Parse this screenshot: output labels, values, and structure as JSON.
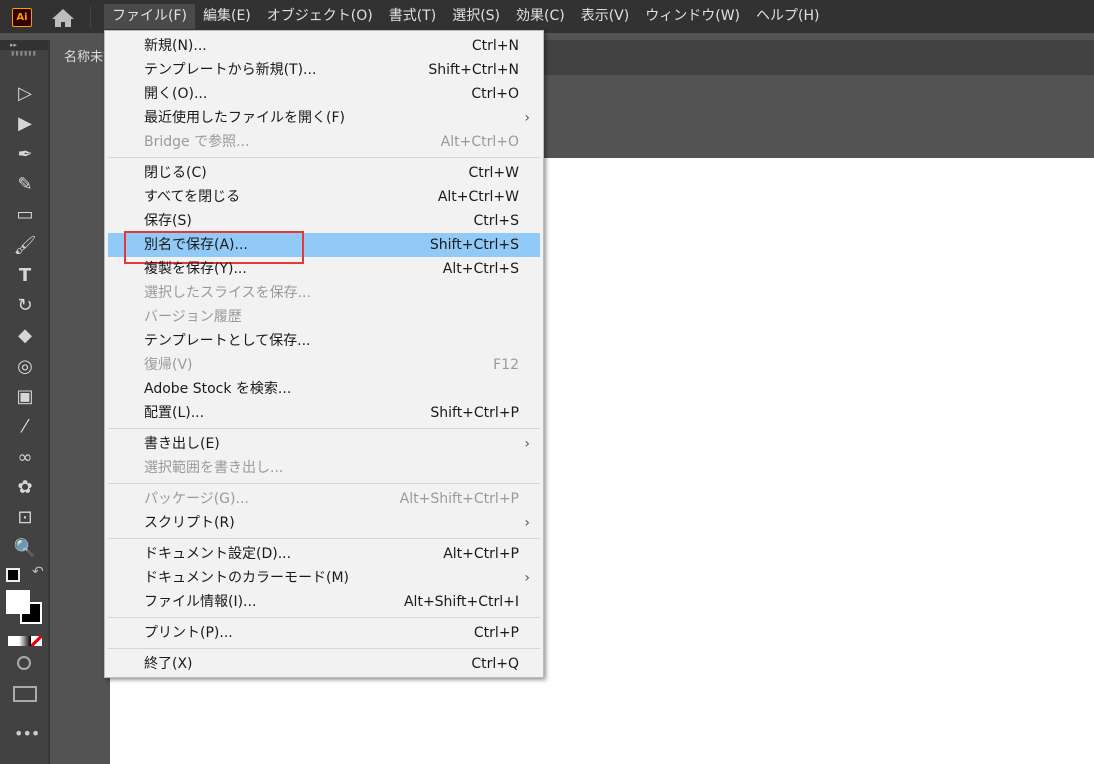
{
  "menubar": {
    "logo": "Ai",
    "items": [
      "ファイル(F)",
      "編集(E)",
      "オブジェクト(O)",
      "書式(T)",
      "選択(S)",
      "効果(C)",
      "表示(V)",
      "ウィンドウ(W)",
      "ヘルプ(H)"
    ]
  },
  "document_tab": "名称未設定",
  "file_menu": [
    {
      "label": "新規(N)...",
      "shortcut": "Ctrl+N"
    },
    {
      "label": "テンプレートから新規(T)...",
      "shortcut": "Shift+Ctrl+N"
    },
    {
      "label": "開く(O)...",
      "shortcut": "Ctrl+O"
    },
    {
      "label": "最近使用したファイルを開く(F)",
      "submenu": true
    },
    {
      "label": "Bridge で参照...",
      "shortcut": "Alt+Ctrl+O",
      "disabled": true
    },
    {
      "sep": true
    },
    {
      "label": "閉じる(C)",
      "shortcut": "Ctrl+W"
    },
    {
      "label": "すべてを閉じる",
      "shortcut": "Alt+Ctrl+W"
    },
    {
      "label": "保存(S)",
      "shortcut": "Ctrl+S"
    },
    {
      "label": "別名で保存(A)...",
      "shortcut": "Shift+Ctrl+S",
      "highlighted": true
    },
    {
      "label": "複製を保存(Y)...",
      "shortcut": "Alt+Ctrl+S"
    },
    {
      "label": "選択したスライスを保存...",
      "disabled": true
    },
    {
      "label": "バージョン履歴",
      "disabled": true
    },
    {
      "label": "テンプレートとして保存..."
    },
    {
      "label": "復帰(V)",
      "shortcut": "F12",
      "disabled": true
    },
    {
      "label": "Adobe Stock を検索..."
    },
    {
      "label": "配置(L)...",
      "shortcut": "Shift+Ctrl+P"
    },
    {
      "sep": true
    },
    {
      "label": "書き出し(E)",
      "submenu": true
    },
    {
      "label": "選択範囲を書き出し...",
      "disabled": true
    },
    {
      "sep": true
    },
    {
      "label": "パッケージ(G)...",
      "shortcut": "Alt+Shift+Ctrl+P",
      "disabled": true
    },
    {
      "label": "スクリプト(R)",
      "submenu": true
    },
    {
      "sep": true
    },
    {
      "label": "ドキュメント設定(D)...",
      "shortcut": "Alt+Ctrl+P"
    },
    {
      "label": "ドキュメントのカラーモード(M)",
      "submenu": true
    },
    {
      "label": "ファイル情報(I)...",
      "shortcut": "Alt+Shift+Ctrl+I"
    },
    {
      "sep": true
    },
    {
      "label": "プリント(P)...",
      "shortcut": "Ctrl+P"
    },
    {
      "sep": true
    },
    {
      "label": "終了(X)",
      "shortcut": "Ctrl+Q"
    }
  ],
  "tools": [
    "selection-tool",
    "direct-selection-tool",
    "pen-tool",
    "curvature-tool",
    "rectangle-tool",
    "paintbrush-tool",
    "type-tool",
    "rotate-tool",
    "eraser-tool",
    "shape-builder-tool",
    "gradient-tool",
    "eyedropper-tool",
    "blend-tool",
    "symbol-sprayer-tool",
    "artboard-tool",
    "zoom-tool"
  ],
  "colors": {
    "accent_highlight": "#91c9f7",
    "annotation": "#e53935"
  }
}
